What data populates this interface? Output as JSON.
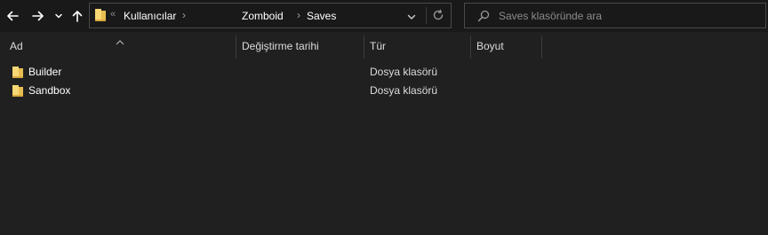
{
  "navigation": {
    "back_icon": "arrow-left-icon",
    "forward_icon": "arrow-right-icon",
    "recent_icon": "chevron-down-icon",
    "up_icon": "arrow-up-icon"
  },
  "address_bar": {
    "folder_icon": "folder-icon",
    "overflow_glyph": "«",
    "breadcrumbs": [
      {
        "label": "Kullanıcılar"
      },
      {
        "label": "Zomboid"
      },
      {
        "label": "Saves"
      }
    ],
    "separator_glyph": "›",
    "dropdown_icon": "chevron-down-icon",
    "refresh_icon": "refresh-icon"
  },
  "search": {
    "placeholder": "Saves klasöründe ara",
    "value": "",
    "icon": "search-icon"
  },
  "columns": [
    {
      "label": "Ad"
    },
    {
      "label": "Değiştirme tarihi"
    },
    {
      "label": "Tür"
    },
    {
      "label": "Boyut"
    }
  ],
  "sort": {
    "column": "Ad",
    "direction": "ascending"
  },
  "items": [
    {
      "name": "Builder",
      "modified": "",
      "type": "Dosya klasörü",
      "size": ""
    },
    {
      "name": "Sandbox",
      "modified": "",
      "type": "Dosya klasörü",
      "size": ""
    }
  ],
  "colors": {
    "background": "#191919",
    "content_background": "#202020",
    "folder_yellow": "#f8d775",
    "border": "#4a4a4a"
  }
}
